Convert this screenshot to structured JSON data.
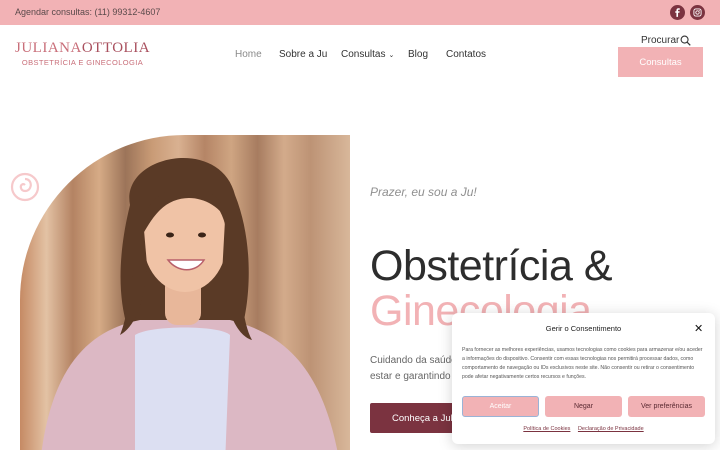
{
  "topbar": {
    "phone": "Agendar consultas: (11) 99312-4607",
    "social": [
      {
        "icon": "facebook-icon"
      },
      {
        "icon": "instagram-icon"
      }
    ]
  },
  "logo": {
    "first": "JULIANA",
    "last": "OTTOLIA",
    "tagline": "OBSTETRÍCIA E GINECOLOGIA"
  },
  "nav": {
    "items": [
      {
        "label": "Home",
        "active": true
      },
      {
        "label": "Sobre a Ju"
      },
      {
        "label": "Consultas",
        "dropdown": true
      },
      {
        "label": "Blog"
      },
      {
        "label": "Contatos"
      }
    ],
    "search_label": "Procurar",
    "cta_label": "Consultas"
  },
  "hero": {
    "intro": "Prazer, eu sou a Ju!",
    "title_line1": "Obstetrícia &",
    "title_line2": "Ginecologia",
    "paragraph_line1": "Cuidando da saúde",
    "paragraph_line2": "estar e garantindo t",
    "button_label": "Conheça a Julia"
  },
  "cookie_banner": {
    "title": "Gerir o Consentimento",
    "body": "Para fornecer as melhores experiências, usamos tecnologias como cookies para armazenar e/ou aceder a informações do dispositivo. Consentir com essas tecnologias nos permitirá processar dados, como comportamento de navegação ou IDs exclusivos neste site. Não consentir ou retirar o consentimento pode afetar negativamente certos recursos e funções.",
    "accept_label": "Aceitar",
    "deny_label": "Negar",
    "prefs_label": "Ver preferências",
    "link_cookies": "Política de Cookies",
    "link_privacy": "Declaração de Privacidade"
  },
  "colors": {
    "pink": "#f2b2b5",
    "wine": "#7b3340",
    "logo_pink": "#c96f7a"
  }
}
